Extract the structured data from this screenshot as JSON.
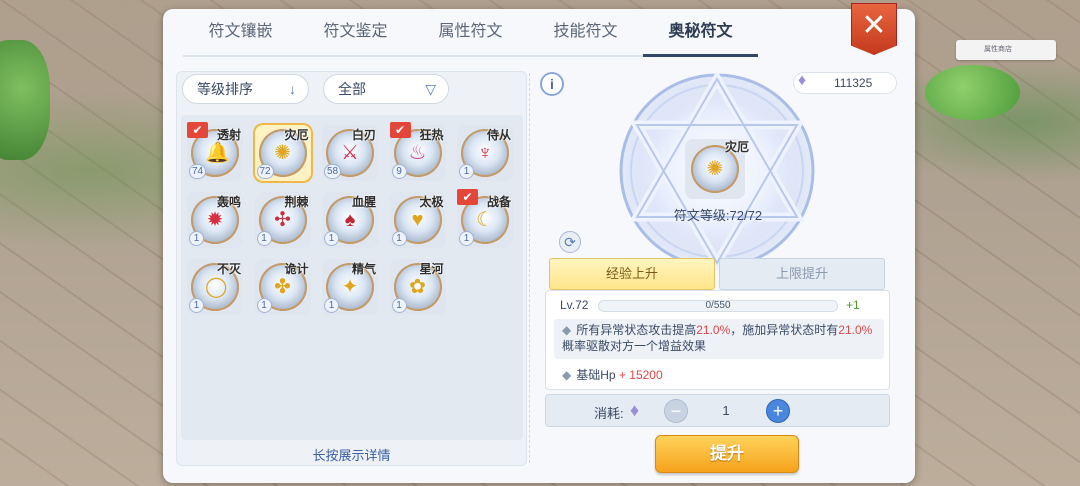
{
  "tabs": [
    {
      "label": "符文镶嵌",
      "active": false
    },
    {
      "label": "符文鉴定",
      "active": false
    },
    {
      "label": "属性符文",
      "active": false
    },
    {
      "label": "技能符文",
      "active": false
    },
    {
      "label": "奥秘符文",
      "active": true
    }
  ],
  "close_label": "✕",
  "background_sign": "属性商店",
  "filters": {
    "sort_label": "等级排序",
    "sort_icon": "↓",
    "category_label": "全部",
    "category_icon": "▽"
  },
  "runes": [
    {
      "name": "透射",
      "count": "74",
      "checked": true,
      "glyph": "🔔",
      "color": "#c0408a"
    },
    {
      "name": "灾厄",
      "count": "72",
      "selected": true,
      "glyph": "✺",
      "color": "#e0a520"
    },
    {
      "name": "白刃",
      "count": "58",
      "glyph": "⚔",
      "color": "#d83050"
    },
    {
      "name": "狂热",
      "count": "9",
      "checked": true,
      "glyph": "♨",
      "color": "#c84090"
    },
    {
      "name": "侍从",
      "count": "1",
      "glyph": "♆",
      "color": "#d03040"
    },
    {
      "name": "轰鸣",
      "count": "1",
      "glyph": "✹",
      "color": "#d83040"
    },
    {
      "name": "荆棘",
      "count": "1",
      "glyph": "✣",
      "color": "#c83040"
    },
    {
      "name": "血腥",
      "count": "1",
      "glyph": "♠",
      "color": "#c02838"
    },
    {
      "name": "太极",
      "count": "1",
      "glyph": "♥",
      "color": "#e0a520"
    },
    {
      "name": "战备",
      "count": "1",
      "checked": true,
      "glyph": "☾",
      "color": "#e0a520"
    },
    {
      "name": "不灭",
      "count": "1",
      "glyph": "◯",
      "color": "#e0a520"
    },
    {
      "name": "诡计",
      "count": "1",
      "glyph": "✤",
      "color": "#e0a520"
    },
    {
      "name": "精气",
      "count": "1",
      "glyph": "✦",
      "color": "#e0a520"
    },
    {
      "name": "星河",
      "count": "1",
      "glyph": "✿",
      "color": "#e0a520"
    }
  ],
  "hint": "长按展示详情",
  "info_icon": "i",
  "currency": {
    "icon": "♦",
    "amount": "111325"
  },
  "selected_rune": {
    "name": "灾厄",
    "glyph": "✺",
    "level_text": "符文等级:72/72"
  },
  "refresh_icon": "⟳",
  "sub_tabs": {
    "exp": "经验上升",
    "cap": "上限提升"
  },
  "level": {
    "label": "Lv.72",
    "progress_text": "0/550",
    "progress": 0,
    "plus": "+1"
  },
  "effect": {
    "p1": "所有异常状态攻击提高",
    "v1": "21.0%",
    "p2": "，施加异常状态时有",
    "v2": "21.0%",
    "p3": "概率驱散对方一个增益效果"
  },
  "hp": {
    "label": "基础Hp",
    "value": "+ 15200"
  },
  "cost": {
    "label": "消耗:",
    "gem": "♦",
    "minus": "−",
    "plus": "+",
    "qty": "1"
  },
  "upgrade_label": "提升",
  "bullet": "◆"
}
